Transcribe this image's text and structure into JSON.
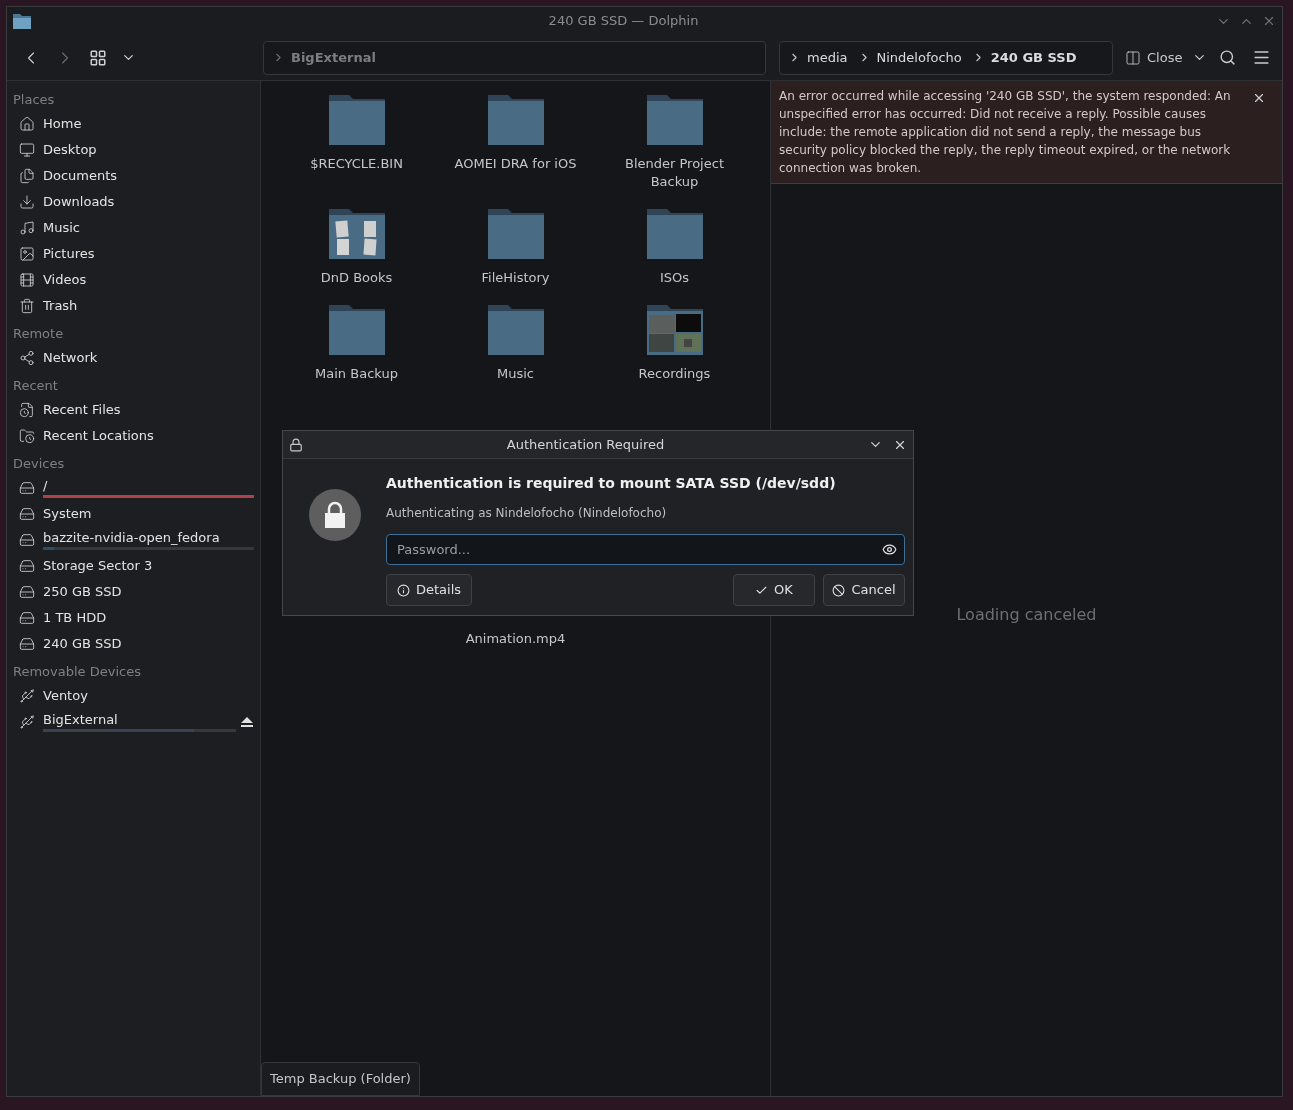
{
  "window": {
    "title": "240 GB SSD — Dolphin"
  },
  "toolbar": {
    "left_path": [
      {
        "label": "BigExternal",
        "current": true
      }
    ],
    "right_path": [
      {
        "label": "media",
        "current": false
      },
      {
        "label": "Nindelofocho",
        "current": false
      },
      {
        "label": "240 GB SSD",
        "current": true
      }
    ],
    "close_label": "Close"
  },
  "sidebar": {
    "sections": [
      {
        "title": "Places",
        "items": [
          {
            "label": "Home",
            "kind": "home"
          },
          {
            "label": "Desktop",
            "kind": "desktop"
          },
          {
            "label": "Documents",
            "kind": "documents"
          },
          {
            "label": "Downloads",
            "kind": "downloads"
          },
          {
            "label": "Music",
            "kind": "music"
          },
          {
            "label": "Pictures",
            "kind": "pictures"
          },
          {
            "label": "Videos",
            "kind": "videos"
          },
          {
            "label": "Trash",
            "kind": "trash"
          }
        ]
      },
      {
        "title": "Remote",
        "items": [
          {
            "label": "Network",
            "kind": "network"
          }
        ]
      },
      {
        "title": "Recent",
        "items": [
          {
            "label": "Recent Files",
            "kind": "recent-files"
          },
          {
            "label": "Recent Locations",
            "kind": "recent-locations"
          }
        ]
      },
      {
        "title": "Devices",
        "items": [
          {
            "label": "/",
            "kind": "drive",
            "level": 1.0,
            "color": "#b0404a"
          },
          {
            "label": "System",
            "kind": "drive"
          },
          {
            "label": "bazzite-nvidia-open_fedora",
            "kind": "drive",
            "level": 0.05,
            "color": "#2c4e6c"
          },
          {
            "label": "Storage Sector 3",
            "kind": "drive"
          },
          {
            "label": "250 GB SSD",
            "kind": "drive"
          },
          {
            "label": "1 TB HDD",
            "kind": "drive"
          },
          {
            "label": "240 GB SSD",
            "kind": "drive"
          }
        ]
      },
      {
        "title": "Removable Devices",
        "items": [
          {
            "label": "Ventoy",
            "kind": "usb"
          },
          {
            "label": "BigExternal",
            "kind": "usb",
            "level": 0.78,
            "color": "#3a4450",
            "eject": true
          }
        ]
      }
    ]
  },
  "files": [
    {
      "label": "$RECYCLE.BIN",
      "kind": "folder"
    },
    {
      "label": "AOMEI DRA for iOS",
      "kind": "folder"
    },
    {
      "label": "Blender Project Backup",
      "kind": "folder"
    },
    {
      "label": "DnD Books",
      "kind": "folder-documents"
    },
    {
      "label": "FileHistory",
      "kind": "folder"
    },
    {
      "label": "ISOs",
      "kind": "folder"
    },
    {
      "label": "Main Backup",
      "kind": "folder"
    },
    {
      "label": "Music",
      "kind": "folder"
    },
    {
      "label": "Recordings",
      "kind": "folder-pictures"
    }
  ],
  "hidden_row_label": "Animation.mp4",
  "status": "Temp Backup (Folder)",
  "error_banner": {
    "text": "An error occurred while accessing '240 GB SSD', the system responded: An unspecified error has occurred: Did not receive a reply. Possible causes include: the remote application did not send a reply, the message bus security policy blocked the reply, the reply timeout expired, or the network connection was broken."
  },
  "right_pane_message": "Loading canceled",
  "dialog": {
    "title": "Authentication Required",
    "heading": "Authentication is required to mount SATA SSD (/dev/sdd)",
    "subtitle": "Authenticating as Nindelofocho (Nindelofocho)",
    "password_placeholder": "Password...",
    "buttons": [
      {
        "label": "Details",
        "kind": "details"
      },
      {
        "label": "OK",
        "kind": "ok"
      },
      {
        "label": "Cancel",
        "kind": "cancel"
      }
    ]
  }
}
